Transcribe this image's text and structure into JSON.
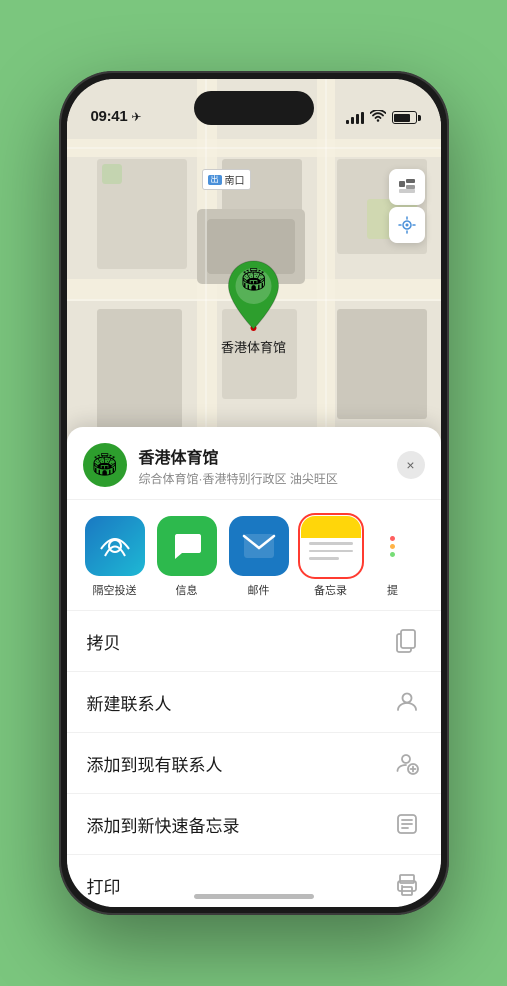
{
  "status_bar": {
    "time": "09:41",
    "location_arrow": "▲"
  },
  "map": {
    "label": "南口",
    "venue_name": "香港体育馆",
    "pin_emoji": "🏟"
  },
  "venue_header": {
    "title": "香港体育馆",
    "subtitle": "综合体育馆·香港特别行政区 油尖旺区",
    "close_label": "×"
  },
  "apps": [
    {
      "id": "airdrop",
      "label": "隔空投送",
      "type": "airdrop"
    },
    {
      "id": "messages",
      "label": "信息",
      "type": "messages"
    },
    {
      "id": "mail",
      "label": "邮件",
      "type": "mail"
    },
    {
      "id": "notes",
      "label": "备忘录",
      "type": "notes",
      "selected": true
    },
    {
      "id": "more",
      "label": "提",
      "type": "more"
    }
  ],
  "actions": [
    {
      "id": "copy",
      "label": "拷贝",
      "icon": "copy"
    },
    {
      "id": "new-contact",
      "label": "新建联系人",
      "icon": "person"
    },
    {
      "id": "add-existing",
      "label": "添加到现有联系人",
      "icon": "person-add"
    },
    {
      "id": "add-note",
      "label": "添加到新快速备忘录",
      "icon": "note"
    },
    {
      "id": "print",
      "label": "打印",
      "icon": "print"
    }
  ],
  "home_indicator": ""
}
